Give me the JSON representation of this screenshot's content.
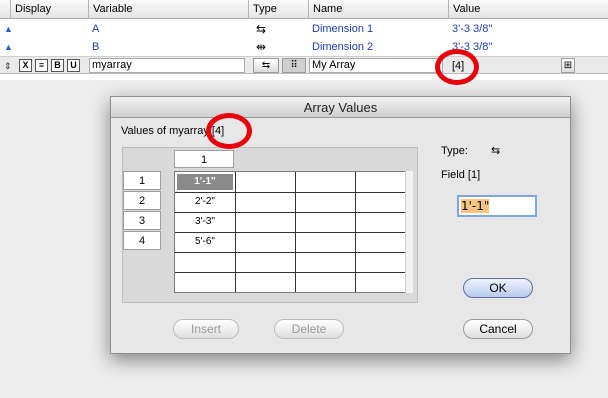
{
  "table": {
    "headers": {
      "display": "Display",
      "variable": "Variable",
      "type": "Type",
      "name": "Name",
      "value": "Value"
    },
    "rows": [
      {
        "variable": "A",
        "name": "Dimension 1",
        "value": "3'-3 3/8\"",
        "type_icon": "dimension-icon",
        "type_glyph": "⇆"
      },
      {
        "variable": "B",
        "name": "Dimension 2",
        "value": "3'-3 3/8\"",
        "type_icon": "dimension-icon",
        "type_glyph": "⇹"
      }
    ],
    "edit_row": {
      "style_buttons": [
        "X",
        "≡",
        "B",
        "U"
      ],
      "variable": "myarray",
      "type_glyph": "⇆",
      "array_glyph": "⠿",
      "name": "My Array",
      "value": "[4]",
      "grid_button": "⊞"
    }
  },
  "dialog": {
    "title": "Array Values",
    "values_of": "Values of myarray",
    "count": "[4]",
    "column_header": "1",
    "row_headers": [
      "1",
      "2",
      "3",
      "4"
    ],
    "values": [
      "1'-1\"",
      "2'-2\"",
      "3'-3\"",
      "5'-6\""
    ],
    "type_label": "Type:",
    "type_glyph": "⇆",
    "field_label": "Field [1]",
    "field_value": "1'-1\"",
    "buttons": {
      "insert": "Insert",
      "delete": "Delete",
      "ok": "OK",
      "cancel": "Cancel"
    }
  },
  "colors": {
    "highlight_ring": "#e8000b",
    "link_blue": "#1c3fb8",
    "selection": "#f8c67e"
  }
}
